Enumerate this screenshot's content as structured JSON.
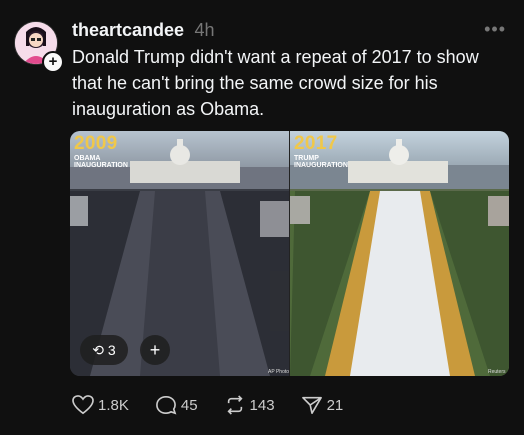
{
  "post": {
    "author": "theartcandee",
    "time": "4h",
    "more_icon": "more-icon",
    "text": "Donald Trump didn't want a repeat of 2017 to show that he can't bring the same crowd size for his inauguration as Obama.",
    "media": {
      "left": {
        "year": "2009",
        "label_line1": "OBAMA",
        "label_line2": "INAUGURATION",
        "credit": "AP Photo"
      },
      "right": {
        "year": "2017",
        "label_line1": "TRUMP",
        "label_line2": "INAUGURATION",
        "credit": "Reuters"
      },
      "repost_count": "3",
      "plus_label": "+"
    },
    "actions": {
      "likes": "1.8K",
      "replies": "45",
      "reposts": "143",
      "shares": "21"
    }
  },
  "colors": {
    "background": "#101010",
    "text": "#f3f5f7",
    "muted": "#777777",
    "year_label": "#f0c84a"
  }
}
